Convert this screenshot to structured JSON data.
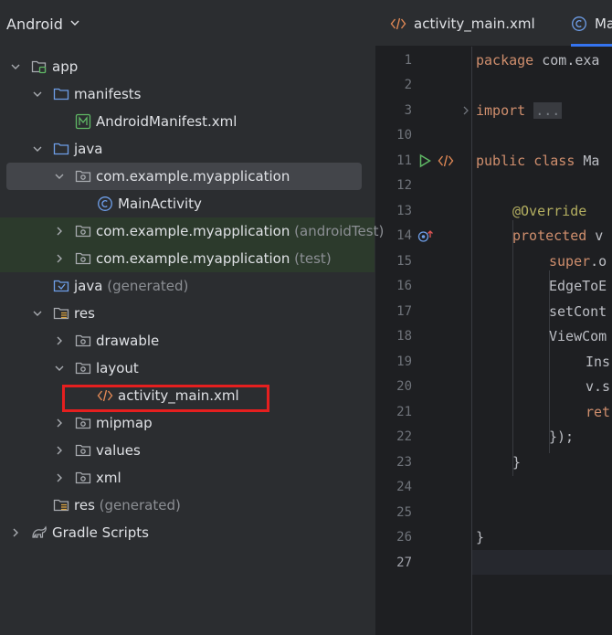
{
  "project_panel": {
    "title": "Android",
    "tree": {
      "app": "app",
      "manifests": "manifests",
      "android_manifest": "AndroidManifest.xml",
      "java": "java",
      "package_main": "com.example.myapplication",
      "main_activity": "MainActivity",
      "package_android_test": "com.example.myapplication",
      "android_test_suffix": "(androidTest)",
      "package_test": "com.example.myapplication",
      "test_suffix": "(test)",
      "java_generated": "java",
      "java_generated_suffix": "(generated)",
      "res": "res",
      "drawable": "drawable",
      "layout": "layout",
      "activity_main_xml": "activity_main.xml",
      "mipmap": "mipmap",
      "values": "values",
      "xml": "xml",
      "res_generated": "res",
      "res_generated_suffix": "(generated)",
      "gradle_scripts": "Gradle Scripts"
    }
  },
  "editor": {
    "tabs": [
      {
        "label": "activity_main.xml",
        "icon": "xml-icon"
      },
      {
        "label": "Ma",
        "icon": "class-icon"
      }
    ],
    "line_numbers": [
      "1",
      "2",
      "3",
      "10",
      "11",
      "12",
      "13",
      "14",
      "15",
      "16",
      "17",
      "18",
      "19",
      "20",
      "21",
      "22",
      "23",
      "24",
      "25",
      "26",
      "27"
    ],
    "code": {
      "l1_kw": "package",
      "l1_rest": " com.exa",
      "l3_kw": "import",
      "l3_fold": "...",
      "l11_kw": "public class",
      "l11_rest": " Ma",
      "l13_ann": "@Override",
      "l14_kw": "protected",
      "l14_rest": " v",
      "l15_kw": "super",
      "l15_rest": ".o",
      "l16": "EdgeToE",
      "l17": "setCont",
      "l18": "ViewCom",
      "l19": "Ins",
      "l20": "v.s",
      "l21_kw": "ret",
      "l22": "});",
      "l23": "}",
      "l26": "}"
    }
  },
  "colors": {
    "panel_bg": "#2b2d30",
    "editor_bg": "#1e1f22",
    "keyword": "#cf8e6d",
    "annotation": "#b3ae60",
    "highlight_box": "#e51f1f",
    "selection": "#43454a",
    "test_source_bg": "#2c3a2c",
    "folder_icon": "#6e9ee8",
    "tab_underline": "#3574f0"
  }
}
